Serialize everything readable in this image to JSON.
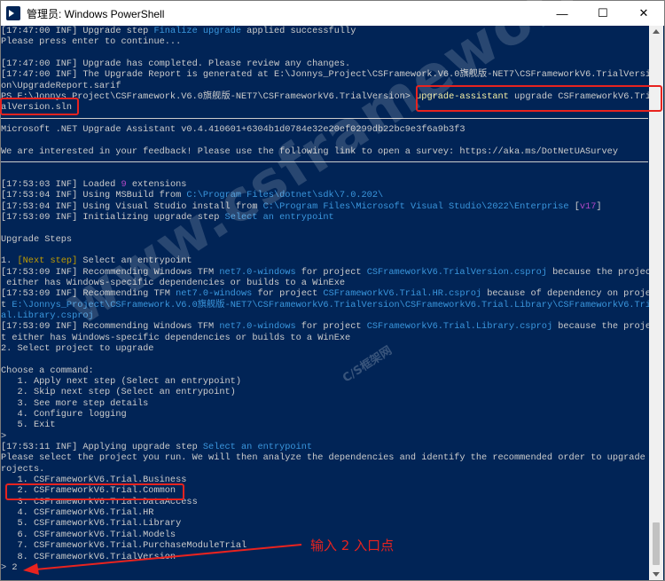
{
  "window": {
    "title": "管理员: Windows PowerShell",
    "controls": {
      "minimize": "—",
      "maximize": "☐",
      "close": "✕"
    }
  },
  "console_lines": [
    [
      {
        "t": "[17:47:00 INF] Upgrade step "
      },
      {
        "t": "Finalize upgrade",
        "c": "c-cyan"
      },
      {
        "t": " applied successfully"
      }
    ],
    [
      {
        "t": "Please press enter to continue..."
      }
    ],
    [
      {
        "t": ""
      }
    ],
    [
      {
        "t": "[17:47:00 INF] Upgrade has completed. Please review any changes."
      }
    ],
    [
      {
        "t": "[17:47:00 INF] The Upgrade Report is generated at E:\\Jonnys_Project\\CSFramework.V6.0旗舰版-NET7\\CSFrameworkV6.TrialVersi"
      }
    ],
    [
      {
        "t": "on\\UpgradeReport.sarif"
      }
    ],
    [
      {
        "t": "PS E:\\Jonnys_Project\\CSFramework.V6.0旗舰版-NET7\\CSFrameworkV6.TrialVersion> "
      },
      {
        "t": "upgrade-assistant",
        "c": "c-yellow"
      },
      {
        "t": " upgrade CSFrameworkV6.Tri"
      }
    ],
    [
      {
        "t": "alVersion.sln"
      }
    ],
    [
      {
        "t": "",
        "rule": true
      }
    ],
    [
      {
        "t": "Microsoft .NET Upgrade Assistant v0.4.410601+6304b1d0784e32e20ef0299db22bc9e3f6a9b3f3"
      }
    ],
    [
      {
        "t": ""
      }
    ],
    [
      {
        "t": "We are interested in your feedback! Please use the following link to open a survey: https://aka.ms/DotNetUASurvey"
      }
    ],
    [
      {
        "t": "",
        "rule": true
      }
    ],
    [
      {
        "t": ""
      }
    ],
    [
      {
        "t": "[17:53:03 INF] Loaded "
      },
      {
        "t": "9",
        "c": "c-purple"
      },
      {
        "t": " extensions"
      }
    ],
    [
      {
        "t": "[17:53:04 INF] Using MSBuild from "
      },
      {
        "t": "C:\\Program Files\\dotnet\\sdk\\7.0.202\\",
        "c": "c-cyan"
      }
    ],
    [
      {
        "t": "[17:53:04 INF] Using Visual Studio install from "
      },
      {
        "t": "C:\\Program Files\\Microsoft Visual Studio\\2022\\Enterprise",
        "c": "c-cyan"
      },
      {
        "t": " ["
      },
      {
        "t": "v17",
        "c": "c-purple"
      },
      {
        "t": "]"
      }
    ],
    [
      {
        "t": "[17:53:09 INF] Initializing upgrade step "
      },
      {
        "t": "Select an entrypoint",
        "c": "c-cyan"
      }
    ],
    [
      {
        "t": ""
      }
    ],
    [
      {
        "t": "Upgrade Steps"
      }
    ],
    [
      {
        "t": ""
      }
    ],
    [
      {
        "t": "1. "
      },
      {
        "t": "[Next step]",
        "c": "c-yellow2"
      },
      {
        "t": " Select an entrypoint"
      }
    ],
    [
      {
        "t": "[17:53:09 INF] Recommending Windows TFM "
      },
      {
        "t": "net7.0-windows",
        "c": "c-cyan"
      },
      {
        "t": " for project "
      },
      {
        "t": "CSFrameworkV6.TrialVersion.csproj",
        "c": "c-cyan"
      },
      {
        "t": " because the project"
      }
    ],
    [
      {
        "t": " either has Windows-specific dependencies or builds to a WinExe"
      }
    ],
    [
      {
        "t": "[17:53:09 INF] Recommending TFM "
      },
      {
        "t": "net7.0-windows",
        "c": "c-cyan"
      },
      {
        "t": " for project "
      },
      {
        "t": "CSFrameworkV6.Trial.HR.csproj",
        "c": "c-cyan"
      },
      {
        "t": " because of dependency on projec"
      }
    ],
    [
      {
        "t": "t "
      },
      {
        "t": "E:\\Jonnys_Project\\CSFramework.V6.0旗舰版-NET7\\CSFrameworkV6.TrialVersion\\CSFrameworkV6.Trial.Library\\CSFrameworkV6.Tri",
        "c": "c-cyan"
      }
    ],
    [
      {
        "t": "al.Library.csproj",
        "c": "c-cyan"
      }
    ],
    [
      {
        "t": "[17:53:09 INF] Recommending Windows TFM "
      },
      {
        "t": "net7.0-windows",
        "c": "c-cyan"
      },
      {
        "t": " for project "
      },
      {
        "t": "CSFrameworkV6.Trial.Library.csproj",
        "c": "c-cyan"
      },
      {
        "t": " because the projec"
      }
    ],
    [
      {
        "t": "t either has Windows-specific dependencies or builds to a WinExe"
      }
    ],
    [
      {
        "t": "2. Select project to upgrade"
      }
    ],
    [
      {
        "t": ""
      }
    ],
    [
      {
        "t": "Choose a command:"
      }
    ],
    [
      {
        "t": "   1. Apply next step (Select an entrypoint)"
      }
    ],
    [
      {
        "t": "   2. Skip next step (Select an entrypoint)"
      }
    ],
    [
      {
        "t": "   3. See more step details"
      }
    ],
    [
      {
        "t": "   4. Configure logging"
      }
    ],
    [
      {
        "t": "   5. Exit"
      }
    ],
    [
      {
        "t": ">"
      }
    ],
    [
      {
        "t": "[17:53:11 INF] Applying upgrade step "
      },
      {
        "t": "Select an entrypoint",
        "c": "c-cyan"
      }
    ],
    [
      {
        "t": "Please select the project you run. We will then analyze the dependencies and identify the recommended order to upgrade p"
      }
    ],
    [
      {
        "t": "rojects."
      }
    ],
    [
      {
        "t": "   1. CSFrameworkV6.Trial.Business"
      }
    ],
    [
      {
        "t": "   2. CSFrameworkV6.Trial.Common"
      }
    ],
    [
      {
        "t": "   3. CSFrameworkV6.Trial.DataAccess"
      }
    ],
    [
      {
        "t": "   4. CSFrameworkV6.Trial.HR"
      }
    ],
    [
      {
        "t": "   5. CSFrameworkV6.Trial.Library"
      }
    ],
    [
      {
        "t": "   6. CSFrameworkV6.Trial.Models"
      }
    ],
    [
      {
        "t": "   7. CSFrameworkV6.Trial.PurchaseModuleTrial"
      }
    ],
    [
      {
        "t": "   8. CSFrameworkV6.TrialVersion"
      }
    ],
    [
      {
        "t": "> 2"
      }
    ]
  ],
  "watermark": {
    "main": "www.csframework",
    "small": "C/S框架网"
  },
  "annotation": {
    "text": "输入 2 入口点"
  },
  "colors": {
    "console_bg": "#012456",
    "highlight": "#e8231f"
  }
}
